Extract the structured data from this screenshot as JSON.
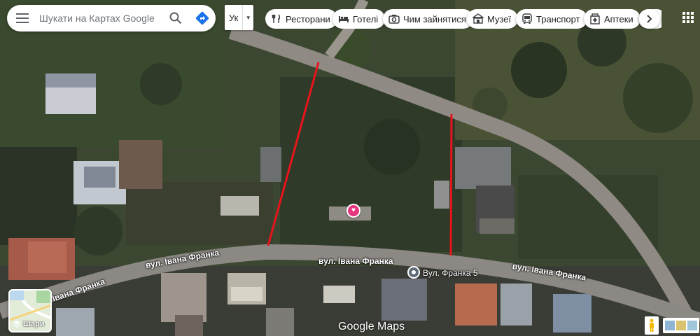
{
  "search": {
    "placeholder": "Шукати на Картах Google"
  },
  "language": {
    "code": "Ук"
  },
  "categories": [
    {
      "label": "Ресторани",
      "icon": "restaurant-icon"
    },
    {
      "label": "Готелі",
      "icon": "hotel-icon"
    },
    {
      "label": "Чим зайнятися",
      "icon": "camera-icon"
    },
    {
      "label": "Музеї",
      "icon": "museum-icon"
    },
    {
      "label": "Транспорт",
      "icon": "bus-icon"
    },
    {
      "label": "Аптеки",
      "icon": "pharmacy-icon"
    }
  ],
  "map": {
    "streets": [
      "Івана Франка",
      "вул. Івана Франка",
      "вул. Івана Франка",
      "вул. Івана Франка"
    ],
    "place": {
      "name": "Вул. Франка 5"
    },
    "layers_label": "Шари",
    "logo": "Google Maps"
  },
  "colors": {
    "boundary_line": "#e8141c",
    "favorite_pin": "#e5357d",
    "road": "#8f8a84"
  }
}
